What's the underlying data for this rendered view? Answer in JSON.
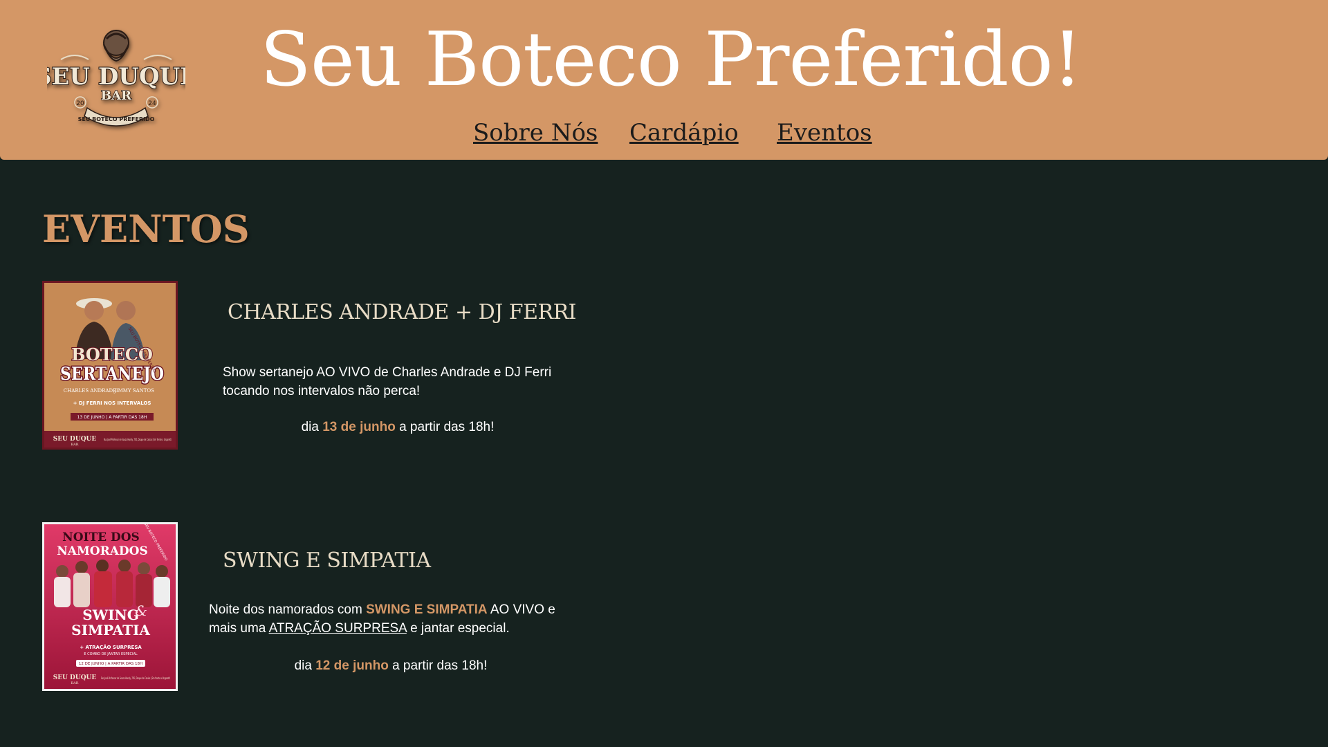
{
  "header": {
    "logo": {
      "name_line": "SEU DUQUE",
      "sub_line": "BAR",
      "year_left": "20",
      "year_right": "24",
      "ribbon": "SEU BOTECO PREFERIDO"
    },
    "title": "Seu Boteco Preferido!",
    "nav": [
      "Sobre Nós",
      "Cardápio",
      "Eventos"
    ]
  },
  "main": {
    "section_title": "EVENTOS",
    "events": [
      {
        "name": "CHARLES ANDRADE + DJ FERRI",
        "desc_text": "Show sertanejo AO VIVO de Charles Andrade e DJ Ferri tocando nos intervalos não perca!",
        "date_prefix": "dia ",
        "date_highlight": "13 de junho",
        "date_suffix": " a partir das 18h!",
        "poster": {
          "title_top": "BOTECO",
          "title_main": "SERTANEJO",
          "ribbon": "SEU BOTECO PREFERIDO",
          "artists_left": "CHARLES ANDRADE",
          "artists_right": "JIMMY SANTOS",
          "extra": "+ DJ FERRI NOS INTERVALOS",
          "date_banner": "13 DE JUNHO | A PARTIR DAS 18H",
          "brand": "SEU DUQUE",
          "brand_sub": "BAR",
          "address": "Rua José Professor de Souza Handy, 765, Duque de Caxias | Em frente a Ungaretti",
          "colors": {
            "bg": "#c68a55",
            "accent": "#7a1a2a"
          }
        }
      },
      {
        "name": "SWING E SIMPATIA",
        "desc_1": "Noite dos namorados com ",
        "desc_hl": "SWING E SIMPATIA",
        "desc_2": " AO VIVO e mais uma ",
        "desc_link": "ATRAÇÃO SURPRESA",
        "desc_3": " e jantar especial.",
        "date_prefix": "dia ",
        "date_highlight": "12 de junho",
        "date_suffix": " a partir das 18h!",
        "poster": {
          "title_1": "NOITE DOS",
          "title_2": "NAMORADOS",
          "ribbon": "SEU BOTECO PREFERIDO",
          "band_1": "SWING",
          "band_amp": "&",
          "band_2": "SIMPATIA",
          "extra_1": "+ ATRAÇÃO SURPRESA",
          "extra_2": "E COMBO DE JANTAR ESPECIAL",
          "date_banner": "12 DE JUNHO | A PARTIR DAS 18H",
          "brand": "SEU DUQUE",
          "brand_sub": "BAR",
          "address": "Rua José Professor de Souza Handy, 765, Duque de Caxias | Em frente a Ungaretti",
          "colors": {
            "bg": "#d3325b",
            "accent": "#7e1029"
          }
        }
      }
    ]
  },
  "colors": {
    "header_bg": "#d49766",
    "page_bg": "#16221f",
    "accent": "#d49766",
    "event_title": "#e8dcc6"
  }
}
